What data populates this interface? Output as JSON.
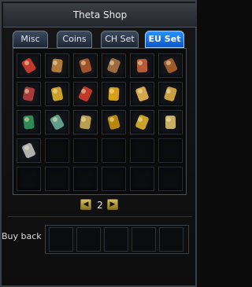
{
  "window": {
    "title": "Theta Shop"
  },
  "tabs": [
    {
      "label": "Misc",
      "active": false
    },
    {
      "label": "Coins",
      "active": false
    },
    {
      "label": "CH Set",
      "active": false
    },
    {
      "label": "EU Set",
      "active": true
    }
  ],
  "items": [
    {
      "name": "gauntlet-item-icon",
      "color": "#c0392b"
    },
    {
      "name": "armor-vest-item-icon",
      "color": "#b07a3a"
    },
    {
      "name": "leg-guard-item-icon",
      "color": "#a0522d"
    },
    {
      "name": "greaves-item-icon",
      "color": "#9c6b3f"
    },
    {
      "name": "boots-item-icon",
      "color": "#b85a3a"
    },
    {
      "name": "gloves-item-icon",
      "color": "#9d5a2a"
    },
    {
      "name": "cloak-item-icon",
      "color": "#a83a3a"
    },
    {
      "name": "ring-item-icon",
      "color": "#c9a227"
    },
    {
      "name": "earring-item-icon",
      "color": "#c0392b"
    },
    {
      "name": "necklace-item-icon",
      "color": "#d4a017"
    },
    {
      "name": "sword-item-icon",
      "color": "#d4a74a"
    },
    {
      "name": "blade-item-icon",
      "color": "#c8a040"
    },
    {
      "name": "spear-item-icon",
      "color": "#2e8b57"
    },
    {
      "name": "crossbow-item-icon",
      "color": "#5f9e8f"
    },
    {
      "name": "axe-item-icon",
      "color": "#b8a050"
    },
    {
      "name": "staff-item-icon",
      "color": "#b8860b"
    },
    {
      "name": "harp-item-icon",
      "color": "#c9a227"
    },
    {
      "name": "dagger-item-icon",
      "color": "#c8b060"
    },
    {
      "name": "claw-item-icon",
      "color": "#b0b0b0"
    }
  ],
  "pager": {
    "page": "2",
    "prev_icon": "triangle-left-icon",
    "next_icon": "triangle-right-icon"
  },
  "buyback": {
    "label": "Buy back"
  }
}
